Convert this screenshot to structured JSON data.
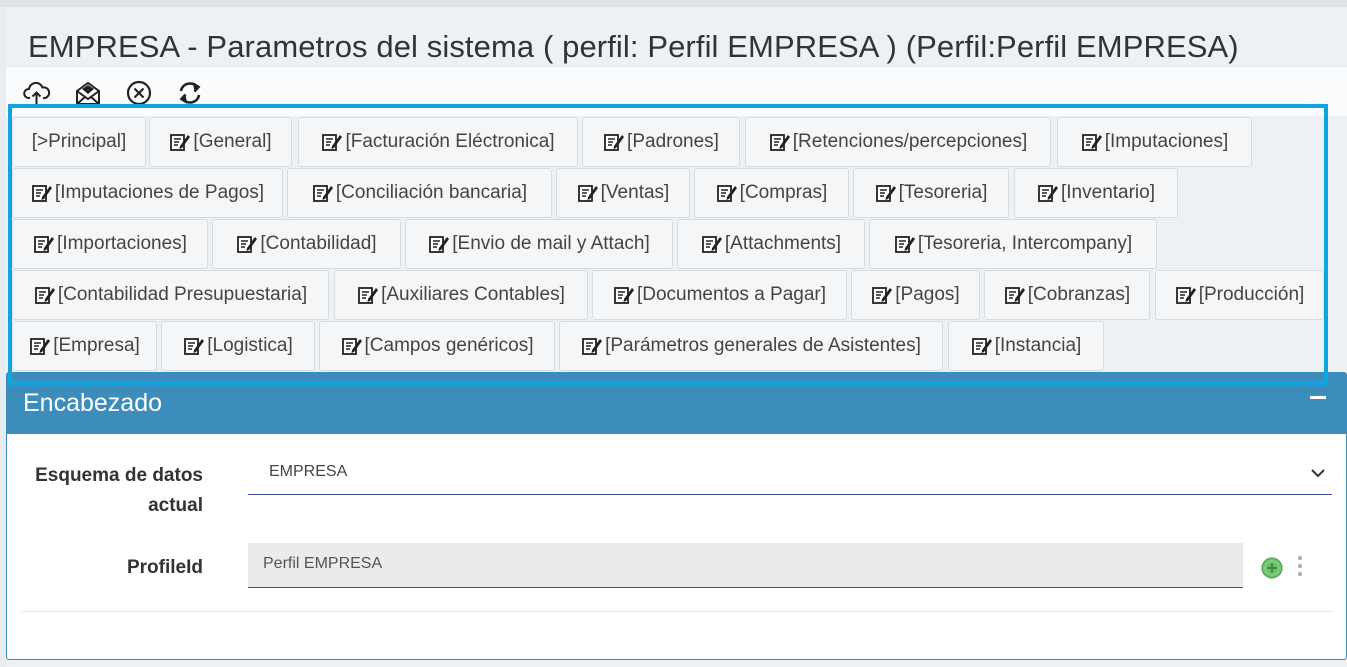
{
  "page": {
    "title": "EMPRESA - Parametros del sistema ( perfil: Perfil EMPRESA ) (Perfil:Perfil EMPRESA)"
  },
  "toolbar": {
    "icons": [
      "cloud-upload-icon",
      "envelope-icon",
      "close-circle-icon",
      "refresh-icon"
    ]
  },
  "tabs": [
    {
      "label": "[>Principal]",
      "icon": false
    },
    {
      "label": "[General]",
      "icon": true
    },
    {
      "label": "[Facturación Eléctronica]",
      "icon": true
    },
    {
      "label": "[Padrones]",
      "icon": true
    },
    {
      "label": "[Retenciones/percepciones]",
      "icon": true
    },
    {
      "label": "[Imputaciones]",
      "icon": true
    },
    {
      "label": "[Imputaciones de Pagos]",
      "icon": true
    },
    {
      "label": "[Conciliación bancaria]",
      "icon": true
    },
    {
      "label": "[Ventas]",
      "icon": true
    },
    {
      "label": "[Compras]",
      "icon": true
    },
    {
      "label": "[Tesoreria]",
      "icon": true
    },
    {
      "label": "[Inventario]",
      "icon": true
    },
    {
      "label": "[Importaciones]",
      "icon": true
    },
    {
      "label": "[Contabilidad]",
      "icon": true
    },
    {
      "label": "[Envio de mail y Attach]",
      "icon": true
    },
    {
      "label": "[Attachments]",
      "icon": true
    },
    {
      "label": "[Tesoreria, Intercompany]",
      "icon": true
    },
    {
      "label": "[Contabilidad Presupuestaria]",
      "icon": true
    },
    {
      "label": "[Auxiliares Contables]",
      "icon": true
    },
    {
      "label": "[Documentos a Pagar]",
      "icon": true
    },
    {
      "label": "[Pagos]",
      "icon": true
    },
    {
      "label": "[Cobranzas]",
      "icon": true
    },
    {
      "label": "[Producción]",
      "icon": true
    },
    {
      "label": "[Empresa]",
      "icon": true
    },
    {
      "label": "[Logistica]",
      "icon": true
    },
    {
      "label": "[Campos genéricos]",
      "icon": true
    },
    {
      "label": "[Parámetros generales de Asistentes]",
      "icon": true
    },
    {
      "label": "[Instancia]",
      "icon": true
    }
  ],
  "panel": {
    "title": "Encabezado",
    "fields": {
      "schema": {
        "label_line1": "Esquema de datos",
        "label_line2": "actual",
        "value": "EMPRESA"
      },
      "profile": {
        "label": "ProfileId",
        "value": "Perfil EMPRESA"
      }
    }
  },
  "colors": {
    "accent": "#3c8dbc",
    "highlight": "#0ea5e0",
    "add_icon": "#5cb85c"
  }
}
